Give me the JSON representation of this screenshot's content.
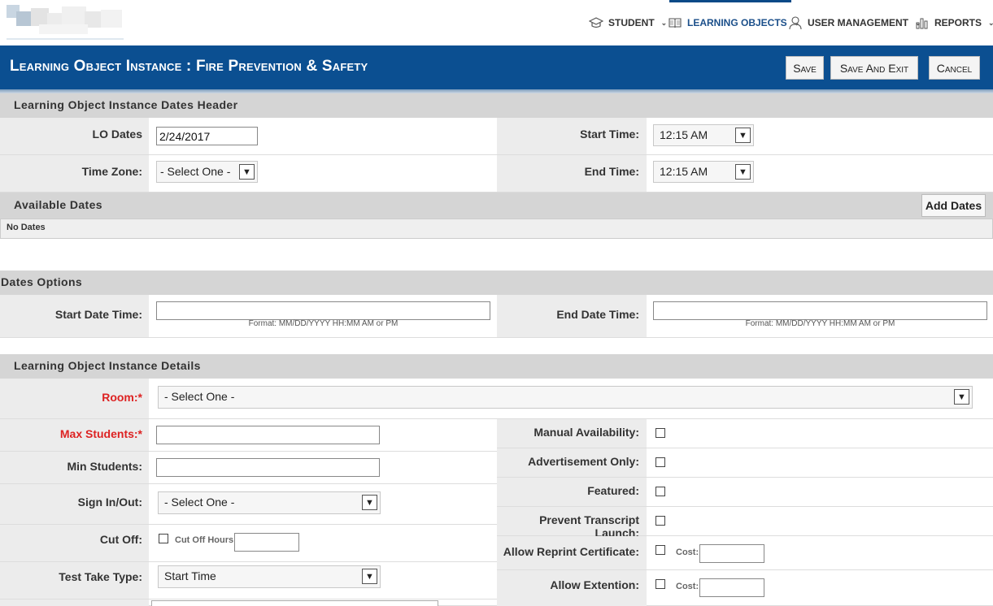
{
  "nav": {
    "student": "STUDENT",
    "learning_objects": "LEARNING OBJECTS",
    "user_management": "USER MANAGEMENT",
    "reports": "REPORTS"
  },
  "title": "Learning Object Instance : Fire Prevention & Safety",
  "toolbar": {
    "save": "Save",
    "save_exit": "Save And Exit",
    "cancel": "Cancel"
  },
  "dates_header": {
    "title": "Learning Object Instance Dates Header",
    "lo_dates_label": "LO Dates",
    "lo_dates_value": "2/24/2017",
    "time_zone_label": "Time Zone:",
    "time_zone_value": "- Select One -",
    "start_time_label": "Start Time:",
    "start_time_value": "12:15 AM",
    "end_time_label": "End Time:",
    "end_time_value": "12:15 AM"
  },
  "available_dates": {
    "title": "Available Dates",
    "add_button": "Add Dates",
    "empty_text": "No Dates"
  },
  "dates_options": {
    "title": "Dates Options",
    "start_label": "Start Date Time:",
    "end_label": "End Date Time:",
    "format_hint": "Format: MM/DD/YYYY HH:MM AM or PM"
  },
  "details": {
    "title": "Learning Object Instance Details",
    "room_label": "Room:*",
    "room_value": "- Select One -",
    "max_students_label": "Max Students:*",
    "min_students_label": "Min Students:",
    "sign_in_label": "Sign In/Out:",
    "sign_in_value": "- Select One -",
    "cut_off_label": "Cut Off:",
    "cut_off_hours": "Cut Off Hours",
    "test_take_label": "Test Take Type:",
    "test_take_value": "Start Time",
    "manual_avail_label": "Manual Availability:",
    "advert_label": "Advertisement Only:",
    "featured_label": "Featured:",
    "prevent_label": "Prevent Transcript Launch:",
    "reprint_label": "Allow Reprint Certificate:",
    "extention_label": "Allow Extention:",
    "cost_label": "Cost:"
  },
  "colors": {
    "brand": "#0b4f91",
    "section": "#d5d5d5",
    "required": "#dd2222"
  }
}
